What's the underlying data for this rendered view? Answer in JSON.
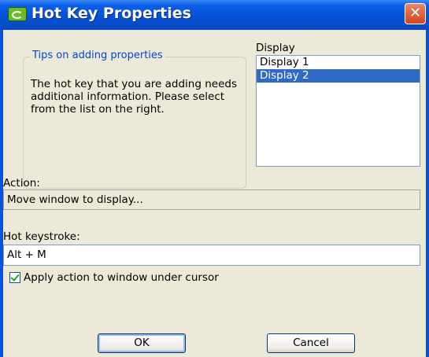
{
  "window": {
    "title": "Hot Key Properties",
    "close_glyph": "✕"
  },
  "tips": {
    "title": "Tips on adding properties",
    "text": "The hot key that you are adding needs additional information. Please select from the list on the right."
  },
  "display": {
    "label": "Display",
    "items": [
      {
        "label": "Display 1",
        "selected": false
      },
      {
        "label": "Display 2",
        "selected": true
      }
    ]
  },
  "action": {
    "label": "Action:",
    "value": "Move window to display..."
  },
  "hotkey": {
    "label": "Hot keystroke:",
    "value": "Alt + M"
  },
  "apply_checkbox": {
    "label": "Apply action to window under cursor",
    "checked": true
  },
  "buttons": {
    "ok": "OK",
    "cancel": "Cancel"
  },
  "colors": {
    "titlebar": "#0550d4",
    "face": "#ece9d8",
    "selection": "#316ac5",
    "group_title": "#0046d5"
  }
}
